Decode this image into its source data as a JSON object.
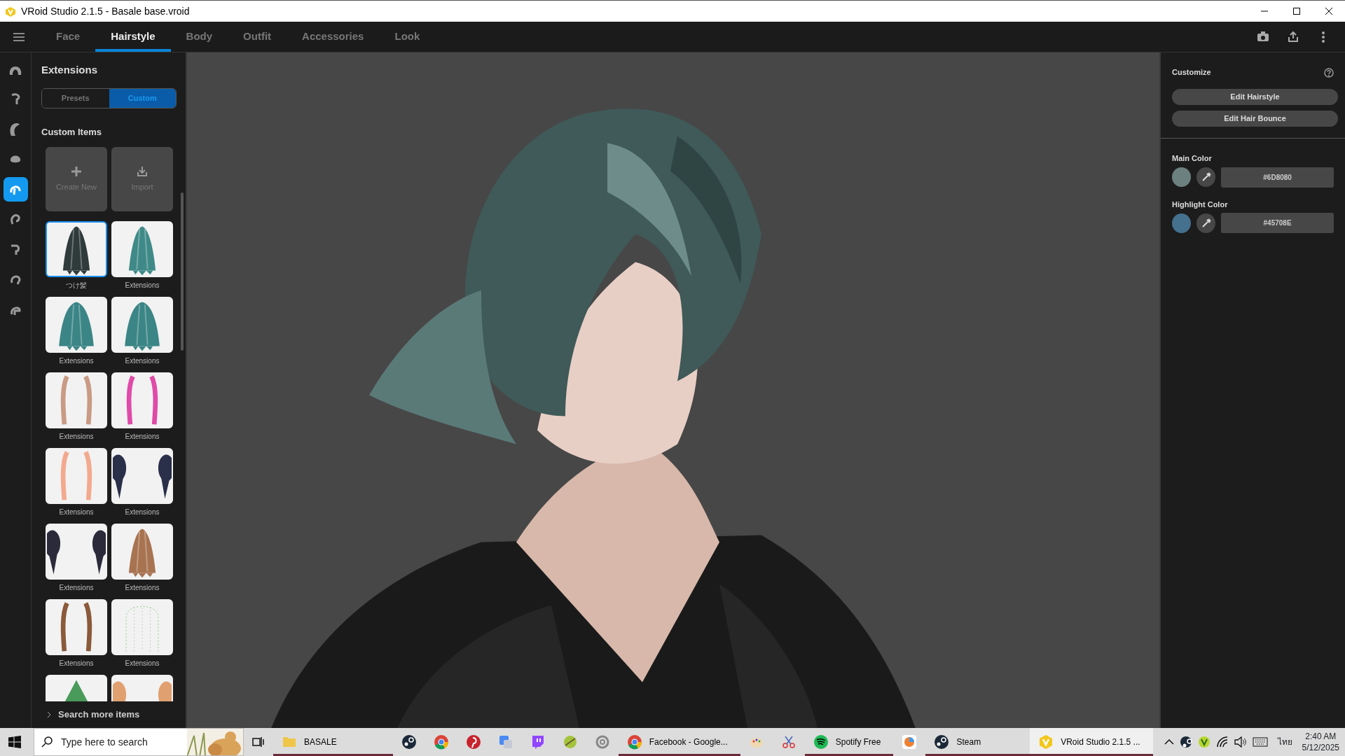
{
  "window": {
    "title": "VRoid Studio 2.1.5 - Basale base.vroid"
  },
  "tabs": [
    {
      "label": "Face",
      "selected": false
    },
    {
      "label": "Hairstyle",
      "selected": true
    },
    {
      "label": "Body",
      "selected": false
    },
    {
      "label": "Outfit",
      "selected": false
    },
    {
      "label": "Accessories",
      "selected": false
    },
    {
      "label": "Look",
      "selected": false
    }
  ],
  "rail": [
    {
      "selected": false
    },
    {
      "selected": false
    },
    {
      "selected": false
    },
    {
      "selected": false
    },
    {
      "selected": true
    },
    {
      "selected": false
    },
    {
      "selected": false
    },
    {
      "selected": false
    },
    {
      "selected": false
    }
  ],
  "panel": {
    "title": "Extensions",
    "segments": [
      {
        "label": "Presets",
        "selected": false
      },
      {
        "label": "Custom",
        "selected": true
      }
    ],
    "section": "Custom Items",
    "actions": [
      {
        "label": "Create New",
        "kind": "create"
      },
      {
        "label": "Import",
        "kind": "import"
      }
    ],
    "items": [
      {
        "label": "つけ髪",
        "selected": true
      },
      {
        "label": "Extensions",
        "selected": false
      },
      {
        "label": "Extensions",
        "selected": false
      },
      {
        "label": "Extensions",
        "selected": false
      },
      {
        "label": "Extensions",
        "selected": false
      },
      {
        "label": "Extensions",
        "selected": false
      },
      {
        "label": "Extensions",
        "selected": false
      },
      {
        "label": "Extensions",
        "selected": false
      },
      {
        "label": "Extensions",
        "selected": false
      },
      {
        "label": "Extensions",
        "selected": false
      },
      {
        "label": "Extensions",
        "selected": false
      },
      {
        "label": "Extensions",
        "selected": false
      },
      {
        "selected": false
      },
      {
        "selected": false
      }
    ],
    "more": "Search more items"
  },
  "customize": {
    "title": "Customize",
    "buttons": [
      "Edit Hairstyle",
      "Edit Hair Bounce"
    ],
    "colors": [
      {
        "label": "Main Color",
        "value": "#6D8080",
        "color": "#6d8080"
      },
      {
        "label": "Highlight Color",
        "value": "#45708E",
        "color": "#45708e"
      }
    ]
  },
  "taskbar": {
    "search": {
      "placeholder": "Type here to search"
    },
    "apps": [
      {
        "kind": "folder",
        "label": "BASALE",
        "running": true,
        "active": false
      },
      {
        "kind": "steam",
        "running": false,
        "active": false
      },
      {
        "kind": "chrome",
        "running": false,
        "active": false
      },
      {
        "kind": "pin",
        "running": false,
        "active": false
      },
      {
        "kind": "translate",
        "running": false,
        "active": false
      },
      {
        "kind": "chat",
        "running": false,
        "active": false
      },
      {
        "kind": "lime",
        "running": false,
        "active": false
      },
      {
        "kind": "ring",
        "running": false,
        "active": false
      },
      {
        "kind": "chrome",
        "label": "Facebook - Google...",
        "running": true,
        "active": false
      },
      {
        "kind": "palette",
        "running": false,
        "active": false
      },
      {
        "kind": "scissors",
        "running": false,
        "active": false
      },
      {
        "kind": "spotify",
        "label": "Spotify Free",
        "running": true,
        "active": false
      },
      {
        "kind": "ball",
        "running": false,
        "active": false
      },
      {
        "kind": "steam",
        "label": "Steam",
        "running": true,
        "active": false
      },
      {
        "kind": "vroid",
        "label": "VRoid Studio 2.1.5 ...",
        "running": true,
        "active": true
      }
    ],
    "tray": {
      "language": "ไทย",
      "time": "2:40 AM",
      "date": "5/12/2025"
    }
  }
}
